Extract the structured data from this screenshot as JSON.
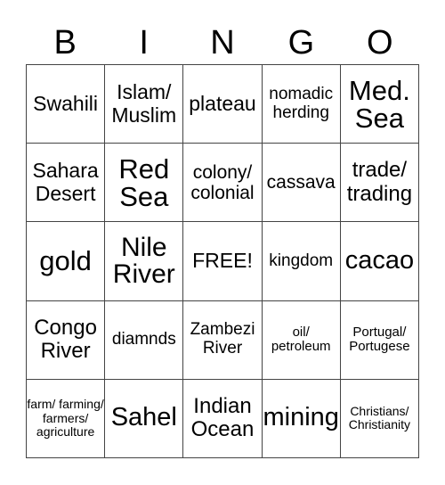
{
  "header": [
    "B",
    "I",
    "N",
    "G",
    "O"
  ],
  "cells": [
    [
      "Swahili",
      "Islam/ Muslim",
      "plateau",
      "nomadic herding",
      "Med. Sea"
    ],
    [
      "Sahara Desert",
      "Red Sea",
      "colony/ colonial",
      "cassava",
      "trade/ trading"
    ],
    [
      "gold",
      "Nile River",
      "FREE!",
      "kingdom",
      "cacao"
    ],
    [
      "Congo River",
      "diamnds",
      "Zambezi River",
      "oil/ petroleum",
      "Portugal/ Portugese"
    ],
    [
      "farm/ farming/ farmers/ agriculture",
      "Sahel",
      "Indian Ocean",
      "mining",
      "Christians/ Christianity"
    ]
  ]
}
